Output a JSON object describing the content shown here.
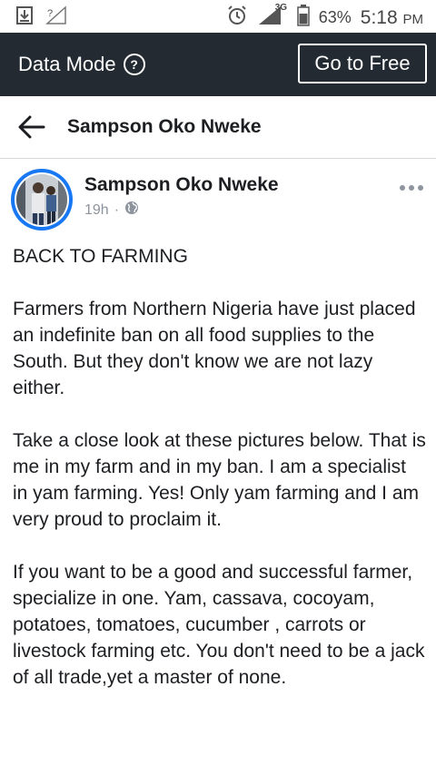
{
  "status_bar": {
    "network": "3G",
    "battery": "63%",
    "time": "5:18",
    "ampm": "PM"
  },
  "data_mode": {
    "label": "Data Mode",
    "button": "Go to Free"
  },
  "header": {
    "title": "Sampson Oko Nweke"
  },
  "post": {
    "author": "Sampson Oko Nweke",
    "time": "19h",
    "separator": "·",
    "paragraphs": [
      "BACK TO FARMING",
      "Farmers from Northern Nigeria have just placed an indefinite ban on all food supplies to the South. But they don't know we are not lazy either.",
      "Take a close look at these pictures below. That is me in my farm and in my ban. I am a specialist in yam farming. Yes! Only yam farming and I am very proud to proclaim it.",
      "If you want to be a good and successful farmer, specialize in one. Yam, cassava, cocoyam, potatoes, tomatoes, cucumber , carrots or livestock farming etc. You don't need to be a jack of all trade,yet a master of none."
    ]
  },
  "icons": {
    "download": "download-icon",
    "signal": "signal-icon",
    "alarm": "alarm-icon",
    "battery": "battery-icon",
    "help": "help-icon",
    "back": "back-arrow-icon",
    "globe": "globe-icon",
    "more": "more-options-icon"
  }
}
